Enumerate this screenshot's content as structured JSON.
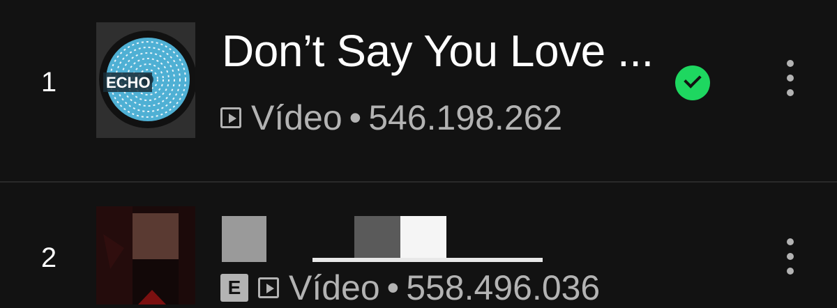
{
  "tracks": [
    {
      "rank": "1",
      "title": "Don’t Say You Love ...",
      "type_label": "Vídeo",
      "separator": "•",
      "plays": "546.198.262",
      "downloaded": true,
      "explicit": false,
      "thumbnail_text": "ECHO"
    },
    {
      "rank": "2",
      "title": "",
      "type_label": "Vídeo",
      "separator": "•",
      "plays": "558.496.036",
      "downloaded": false,
      "explicit": true,
      "explicit_label": "E"
    }
  ],
  "colors": {
    "background": "#121212",
    "text_primary": "#ffffff",
    "text_secondary": "#b3b3b3",
    "accent_green": "#1ed760"
  },
  "icons": [
    "video-icon",
    "downloaded-check-icon",
    "more-options-icon",
    "explicit-badge"
  ]
}
